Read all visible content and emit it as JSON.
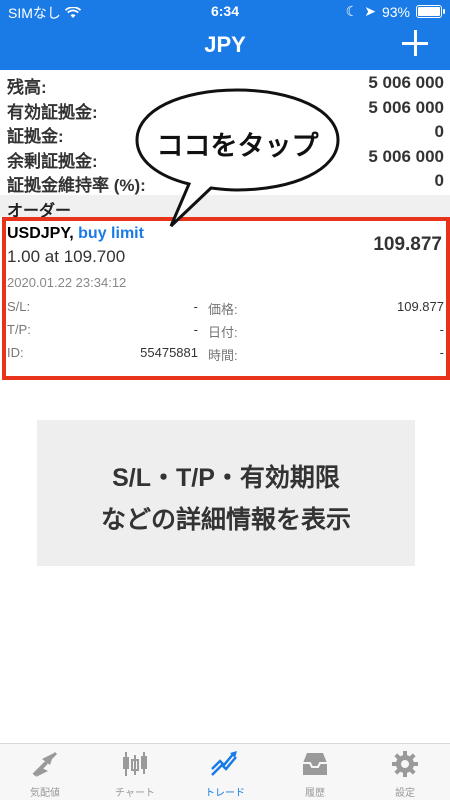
{
  "status_bar": {
    "carrier": "SIMなし",
    "time": "6:34",
    "battery": "93%"
  },
  "header": {
    "title": "JPY"
  },
  "summary": [
    {
      "label": "残高:",
      "value": "5 006 000"
    },
    {
      "label": "有効証拠金:",
      "value": "5 006 000"
    },
    {
      "label": "証拠金:",
      "value": "0"
    },
    {
      "label": "余剰証拠金:",
      "value": "5 006 000"
    },
    {
      "label": "証拠金維持率 (%):",
      "value": "0"
    }
  ],
  "section_title": "オーダー",
  "order": {
    "symbol": "USDJPY,",
    "type": "buy limit",
    "volume_price": "1.00 at 109.700",
    "current_price": "109.877",
    "timestamp": "2020.01.22 23:34:12",
    "details": [
      {
        "lk": "S/L:",
        "lv": "-",
        "rk": "価格:",
        "rv": "109.877"
      },
      {
        "lk": "T/P:",
        "lv": "-",
        "rk": "日付:",
        "rv": "-"
      },
      {
        "lk": "ID:",
        "lv": "55475881",
        "rk": "時間:",
        "rv": "-"
      }
    ]
  },
  "callout": {
    "text": "ココをタップ"
  },
  "info_box": {
    "line1": "S/L・T/P・有効期限",
    "line2": "などの詳細情報を表示"
  },
  "tabs": [
    {
      "label": "気配値",
      "icon": "quotes-icon",
      "active": false
    },
    {
      "label": "チャート",
      "icon": "chart-icon",
      "active": false
    },
    {
      "label": "トレード",
      "icon": "trade-icon",
      "active": true
    },
    {
      "label": "履歴",
      "icon": "history-icon",
      "active": false
    },
    {
      "label": "設定",
      "icon": "settings-icon",
      "active": false
    }
  ],
  "colors": {
    "accent": "#1a7be6",
    "highlight": "#e8321a"
  }
}
